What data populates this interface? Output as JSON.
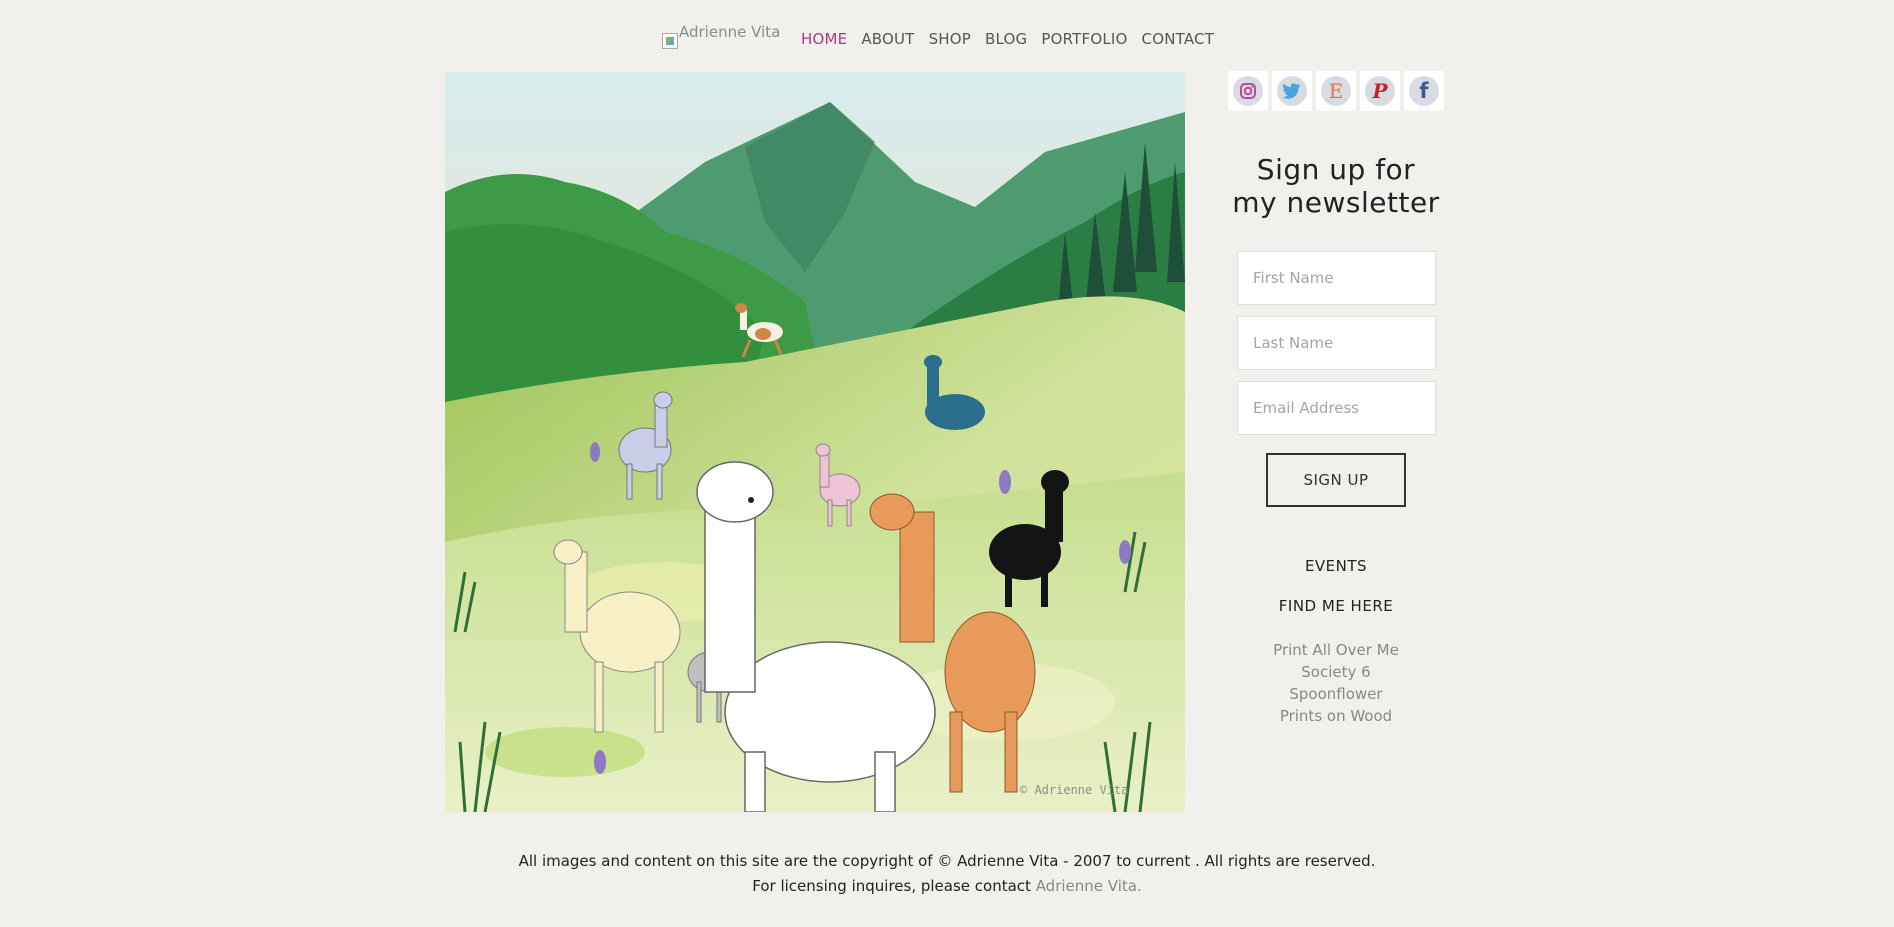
{
  "header": {
    "logo_alt": "Adrienne Vita",
    "nav": [
      "HOME",
      "ABOUT",
      "SHOP",
      "BLOG",
      "PORTFOLIO",
      "CONTACT"
    ]
  },
  "painting": {
    "watermark": "© Adrienne Vita"
  },
  "social": {
    "icons": [
      "instagram-icon",
      "twitter-icon",
      "etsy-icon",
      "pinterest-icon",
      "facebook-icon"
    ],
    "etsy_glyph": "E",
    "pinterest_glyph": "P",
    "facebook_glyph": "f"
  },
  "newsletter": {
    "title_line1": "Sign up for",
    "title_line2": "my newsletter",
    "first_name_placeholder": "First Name",
    "last_name_placeholder": "Last Name",
    "email_placeholder": "Email Address",
    "button": "SIGN UP"
  },
  "sidebar": {
    "events": "EVENTS",
    "find_me": "FIND ME HERE",
    "links": [
      "Print All Over Me",
      "Society 6",
      "Spoonflower",
      "Prints on Wood"
    ]
  },
  "footer": {
    "line1": "All images and content on this site are the copyright of © Adrienne Vita - 2007 to current . All rights are reserved.",
    "line2_prefix": "For licensing inquires, please contact ",
    "line2_link": "Adrienne Vita."
  },
  "colors": {
    "background": "#f1f0ec",
    "nav_active": "#a3407e",
    "link_muted": "#888888"
  }
}
